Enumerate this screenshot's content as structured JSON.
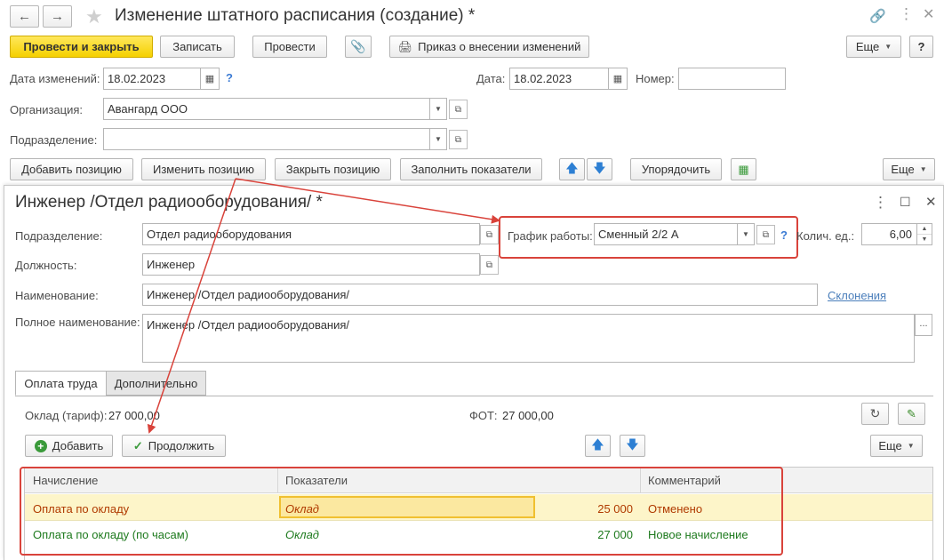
{
  "window": {
    "title": "Изменение штатного расписания (создание) *"
  },
  "toolbar": {
    "post_close": "Провести и закрыть",
    "save": "Записать",
    "post": "Провести",
    "order": "Приказ о внесении изменений",
    "more": "Еще",
    "help": "?"
  },
  "header": {
    "change_date_label": "Дата изменений:",
    "change_date_value": "18.02.2023",
    "date_label": "Дата:",
    "date_value": "18.02.2023",
    "number_label": "Номер:",
    "number_value": "",
    "org_label": "Организация:",
    "org_value": "Авангард ООО",
    "dept_label": "Подразделение:",
    "dept_value": ""
  },
  "position_toolbar": {
    "add": "Добавить позицию",
    "change": "Изменить позицию",
    "close": "Закрыть позицию",
    "fill": "Заполнить показатели",
    "sort": "Упорядочить",
    "more": "Еще"
  },
  "dialog": {
    "title": "Инженер /Отдел радиооборудования/ *",
    "dept_label": "Подразделение:",
    "dept_value": "Отдел радиооборудования",
    "position_label": "Должность:",
    "position_value": "Инженер",
    "name_label": "Наименование:",
    "name_value": "Инженер /Отдел радиооборудования/",
    "declension_link": "Склонения",
    "fullname_label": "Полное наименование:",
    "fullname_value": "Инженер /Отдел радиооборудования/",
    "schedule_label": "График работы:",
    "schedule_value": "Сменный 2/2 А",
    "qty_label": "Колич. ед.:",
    "qty_value": "6,00",
    "tabs": [
      "Оплата труда",
      "Дополнительно"
    ],
    "salary_label": "Оклад (тариф):",
    "salary_value": "27 000,00",
    "fot_label": "ФОТ:",
    "fot_value": "27 000,00",
    "add_button": "Добавить",
    "continue_button": "Продолжить",
    "more": "Еще",
    "table": {
      "headers": [
        "Начисление",
        "Показатели",
        "Комментарий"
      ],
      "rows": [
        {
          "accrual": "Оплата по окладу",
          "indicator": "Оклад",
          "amount": "25 000",
          "comment": "Отменено"
        },
        {
          "accrual": "Оплата по окладу (по часам)",
          "indicator": "Оклад",
          "amount": "27 000",
          "comment": "Новое начисление"
        }
      ]
    }
  },
  "colors": {
    "primary_button": "#f5d000",
    "highlight_frame": "#d9433b",
    "selected_row": "#fdf5c9",
    "row1_text": "#b03a00",
    "row2_text": "#1e7a1e"
  }
}
